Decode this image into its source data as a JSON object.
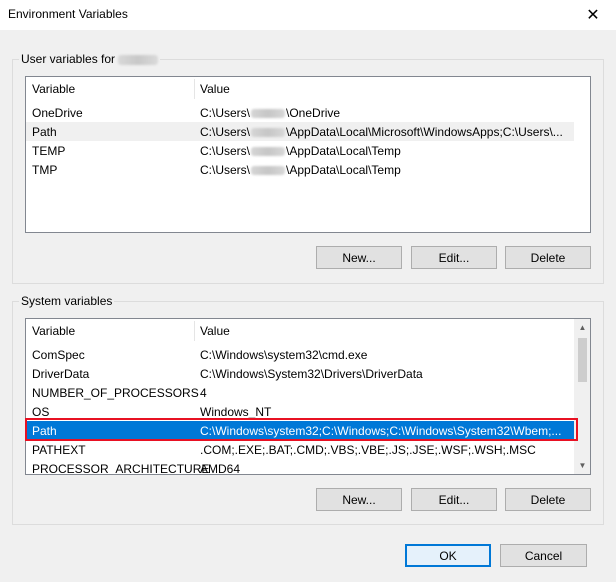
{
  "window": {
    "title": "Environment Variables",
    "close_glyph": "✕"
  },
  "user_vars": {
    "group_label": "User variables for",
    "columns": {
      "variable": "Variable",
      "value": "Value"
    },
    "rows": [
      {
        "name": "OneDrive",
        "value_prefix": "C:\\Users\\",
        "value_suffix": "\\OneDrive"
      },
      {
        "name": "Path",
        "value_prefix": "C:\\Users\\",
        "value_suffix": "\\AppData\\Local\\Microsoft\\WindowsApps;C:\\Users\\..."
      },
      {
        "name": "TEMP",
        "value_prefix": "C:\\Users\\",
        "value_suffix": "\\AppData\\Local\\Temp"
      },
      {
        "name": "TMP",
        "value_prefix": "C:\\Users\\",
        "value_suffix": "\\AppData\\Local\\Temp"
      }
    ],
    "buttons": {
      "new": "New...",
      "edit": "Edit...",
      "delete": "Delete"
    }
  },
  "system_vars": {
    "group_label": "System variables",
    "columns": {
      "variable": "Variable",
      "value": "Value"
    },
    "rows": [
      {
        "name": "ComSpec",
        "value": "C:\\Windows\\system32\\cmd.exe"
      },
      {
        "name": "DriverData",
        "value": "C:\\Windows\\System32\\Drivers\\DriverData"
      },
      {
        "name": "NUMBER_OF_PROCESSORS",
        "value": "4"
      },
      {
        "name": "OS",
        "value": "Windows_NT"
      },
      {
        "name": "Path",
        "value": "C:\\Windows\\system32;C:\\Windows;C:\\Windows\\System32\\Wbem;..."
      },
      {
        "name": "PATHEXT",
        "value": ".COM;.EXE;.BAT;.CMD;.VBS;.VBE;.JS;.JSE;.WSF;.WSH;.MSC"
      },
      {
        "name": "PROCESSOR_ARCHITECTURE",
        "value": "AMD64"
      }
    ],
    "selected_row": "Path",
    "buttons": {
      "new": "New...",
      "edit": "Edit...",
      "delete": "Delete"
    }
  },
  "footer": {
    "ok": "OK",
    "cancel": "Cancel"
  },
  "colors": {
    "selection": "#0078d7",
    "highlight_outline": "#e81123",
    "default_button_border": "#0078d7"
  }
}
